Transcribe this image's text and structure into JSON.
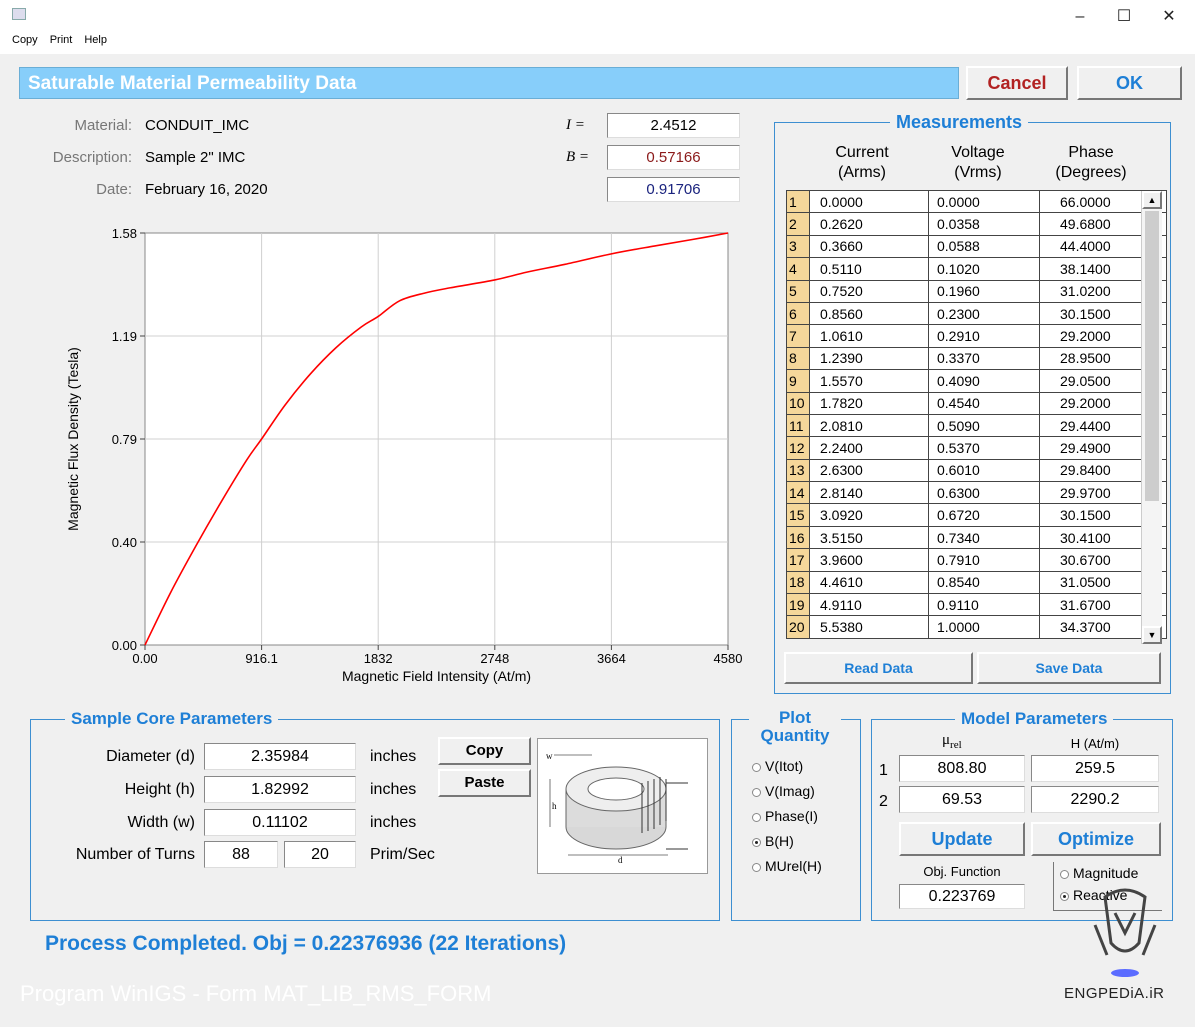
{
  "window": {
    "minimize": "–",
    "maximize": "☐",
    "close": "✕"
  },
  "menu": [
    "Copy",
    "Print",
    "Help"
  ],
  "header": {
    "title": "Saturable Material  Permeability Data",
    "cancel": "Cancel",
    "ok": "OK"
  },
  "info": {
    "material_label": "Material:",
    "material": "CONDUIT_IMC",
    "description_label": "Description:",
    "description": "Sample 2\" IMC",
    "date_label": "Date:",
    "date": "February 16, 2020",
    "i_label": "I =",
    "i_value": "2.4512",
    "b_label": "B =",
    "b_value": "0.57166",
    "third_value": "0.91706"
  },
  "chart_data": {
    "type": "line",
    "xlabel": "Magnetic Field Intensity (At/m)",
    "ylabel": "Magnetic Flux Density (Tesla)",
    "xlim": [
      0,
      4580
    ],
    "ylim": [
      0,
      1.58
    ],
    "xticks": [
      "0.00",
      "916.1",
      "1832",
      "2748",
      "3664",
      "4580"
    ],
    "yticks": [
      "0.00",
      "0.40",
      "0.79",
      "1.19",
      "1.58"
    ],
    "grid": true,
    "series": [
      {
        "color": "#ff0000",
        "x": [
          0,
          200,
          400,
          600,
          800,
          916,
          1100,
          1300,
          1500,
          1700,
          1832,
          2000,
          2200,
          2400,
          2748,
          3000,
          3300,
          3664,
          4000,
          4300,
          4580
        ],
        "y": [
          0,
          0.2,
          0.38,
          0.55,
          0.71,
          0.79,
          0.92,
          1.04,
          1.14,
          1.22,
          1.26,
          1.32,
          1.35,
          1.37,
          1.4,
          1.43,
          1.46,
          1.5,
          1.53,
          1.555,
          1.58
        ]
      }
    ]
  },
  "measurements": {
    "title": "Measurements",
    "col_current": [
      "Current",
      "(Arms)"
    ],
    "col_voltage": [
      "Voltage",
      "(Vrms)"
    ],
    "col_phase": [
      "Phase",
      "(Degrees)"
    ],
    "rows": [
      [
        "1",
        "0.0000",
        "0.0000",
        "66.0000"
      ],
      [
        "2",
        "0.2620",
        "0.0358",
        "49.6800"
      ],
      [
        "3",
        "0.3660",
        "0.0588",
        "44.4000"
      ],
      [
        "4",
        "0.5110",
        "0.1020",
        "38.1400"
      ],
      [
        "5",
        "0.7520",
        "0.1960",
        "31.0200"
      ],
      [
        "6",
        "0.8560",
        "0.2300",
        "30.1500"
      ],
      [
        "7",
        "1.0610",
        "0.2910",
        "29.2000"
      ],
      [
        "8",
        "1.2390",
        "0.3370",
        "28.9500"
      ],
      [
        "9",
        "1.5570",
        "0.4090",
        "29.0500"
      ],
      [
        "10",
        "1.7820",
        "0.4540",
        "29.2000"
      ],
      [
        "11",
        "2.0810",
        "0.5090",
        "29.4400"
      ],
      [
        "12",
        "2.2400",
        "0.5370",
        "29.4900"
      ],
      [
        "13",
        "2.6300",
        "0.6010",
        "29.8400"
      ],
      [
        "14",
        "2.8140",
        "0.6300",
        "29.9700"
      ],
      [
        "15",
        "3.0920",
        "0.6720",
        "30.1500"
      ],
      [
        "16",
        "3.5150",
        "0.7340",
        "30.4100"
      ],
      [
        "17",
        "3.9600",
        "0.7910",
        "30.6700"
      ],
      [
        "18",
        "4.4610",
        "0.8540",
        "31.0500"
      ],
      [
        "19",
        "4.9110",
        "0.9110",
        "31.6700"
      ],
      [
        "20",
        "5.5380",
        "1.0000",
        "34.3700"
      ]
    ],
    "read_data": "Read Data",
    "save_data": "Save Data"
  },
  "core": {
    "title": "Sample Core Parameters",
    "diameter_label": "Diameter (d)",
    "diameter": "2.35984",
    "diameter_unit": "inches",
    "height_label": "Height (h)",
    "height": "1.82992",
    "height_unit": "inches",
    "width_label": "Width (w)",
    "width": "0.11102",
    "width_unit": "inches",
    "turns_label": "Number of Turns",
    "turns_prim": "88",
    "turns_sec": "20",
    "turns_unit": "Prim/Sec",
    "copy": "Copy",
    "paste": "Paste",
    "diagram": {
      "w": "w",
      "h": "h",
      "d": "d"
    }
  },
  "plot_quantity": {
    "title": [
      "Plot",
      "Quantity"
    ],
    "options": [
      "V(Itot)",
      "V(Imag)",
      "Phase(I)",
      "B(H)",
      "MUrel(H)"
    ],
    "selected": "B(H)"
  },
  "model": {
    "title": "Model Parameters",
    "col_mu": "μ",
    "col_mu_sub": "rel",
    "col_h": "H (At/m)",
    "rows": [
      [
        "1",
        "808.80",
        "259.5"
      ],
      [
        "2",
        "69.53",
        "2290.2"
      ]
    ],
    "update": "Update",
    "optimize": "Optimize",
    "obj_label": "Obj. Function",
    "obj_value": "0.223769",
    "options": [
      "Magnitude",
      "Reactive"
    ],
    "selected": "Reactive"
  },
  "status": "Process Completed.  Obj = 0.22376936 (22 Iterations)",
  "footer_program": "Program WinIGS - Form MAT_LIB_RMS_FORM",
  "watermark": "ENGPEDiA.iR",
  "colors": {
    "header": "#87cefa",
    "accent": "#1e7fd6",
    "curve": "#ff0000",
    "cancel": "#b22222"
  }
}
